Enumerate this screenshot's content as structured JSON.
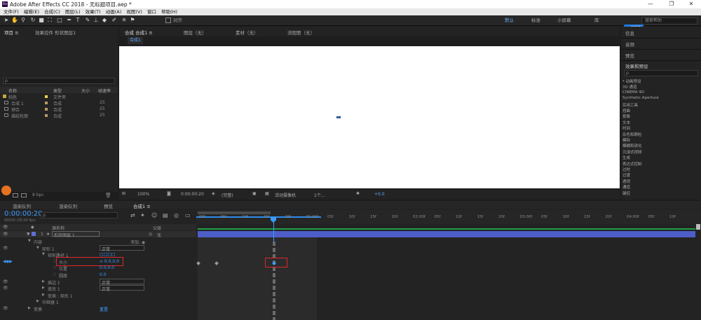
{
  "window": {
    "title": "Adobe After Effects CC 2018 - 无标题项目.aep *",
    "logo_text": "Ae",
    "minimize": "—",
    "restore": "❐",
    "close": "✕"
  },
  "menu": [
    "文件(F)",
    "编辑(E)",
    "合成(C)",
    "图层(L)",
    "效果(T)",
    "动画(A)",
    "视图(V)",
    "窗口",
    "帮助(H)"
  ],
  "toolbar": {
    "snap_label": "对齐",
    "workspaces": [
      "默认",
      "标准",
      "小屏幕",
      "库"
    ],
    "search_placeholder": "搜索帮助",
    "cloud_badge": "已加速"
  },
  "project": {
    "tab_label": "项目 ≡",
    "effects_tab": "效果控件 形状图层1",
    "search_placeholder": "ρ.",
    "columns": [
      "名称",
      "类型",
      "大小",
      "帧速率"
    ],
    "items": [
      {
        "name": "纯色",
        "type": "文件夹",
        "fps": ""
      },
      {
        "name": "合成 1",
        "type": "合成",
        "fps": "25"
      },
      {
        "name": "预合",
        "type": "合成",
        "fps": "25"
      },
      {
        "name": "描绘轮廓",
        "type": "合成",
        "fps": "25"
      }
    ],
    "bpc": "8 bpc"
  },
  "comp": {
    "tabs": [
      "合成 合成1 ≡",
      "图层（无）",
      "素材（无）",
      "流程图（无）"
    ],
    "breadcrumb": "合成1",
    "zoom": "100%",
    "timecode": "0:00:00:20",
    "resolution": "(完整)",
    "camera": "活动摄像机",
    "views": "1个...",
    "offset": "+0.0"
  },
  "right": {
    "items": [
      "信息",
      "音频",
      "预览"
    ],
    "effects_title": "效果和预设",
    "search_placeholder": "ρ.",
    "tree": [
      "* 动画预设",
      "3D 通道",
      "CINEMA 4D",
      "Synthetic Aperture",
      "实用工具",
      "扭曲",
      "抠像",
      "文本",
      "时间",
      "杂色和颗粒",
      "模拟",
      "模糊和锐化",
      "沉浸式视频",
      "生成",
      "表达式控制",
      "过时",
      "过渡",
      "透视",
      "通道",
      "键控"
    ]
  },
  "timeline": {
    "tabs": [
      "渲染队列",
      "渲染队列",
      "预览",
      "合成1 ≡"
    ],
    "timecode": "0:00:00:20",
    "timecode_sub": "00020 (25.00 fps)",
    "search_placeholder": "ρ.",
    "col_source": "源名称",
    "col_parent": "父级",
    "parent_value": "无",
    "layer_num": "1",
    "layer_name": "形状图层 1",
    "add_label": "添加: ◉",
    "ruler": [
      "00f",
      "05f",
      "10f",
      "15f",
      "20f",
      "01:00f",
      "05f",
      "10f",
      "15f",
      "20f",
      "02:00f",
      "05f",
      "10f",
      "15f",
      "20f",
      "03:00f",
      "05f",
      "10f",
      "15f",
      "20f",
      "04:00f",
      "05f",
      "10f"
    ],
    "props": [
      {
        "label": "内容",
        "value": ""
      },
      {
        "label": "矩形 1",
        "value": "正常"
      },
      {
        "label": "矩形路径 1",
        "value": "□□□□"
      },
      {
        "label": "大小",
        "value": "∞ 0.0,0.0"
      },
      {
        "label": "位置",
        "value": "0.0,0.0"
      },
      {
        "label": "圆度",
        "value": "0.0"
      },
      {
        "label": "描边 1",
        "value": "正常"
      },
      {
        "label": "填充 1",
        "value": "正常"
      },
      {
        "label": "变换 : 矩形 1",
        "value": ""
      },
      {
        "label": "中继器 1",
        "value": ""
      },
      {
        "label": "变换",
        "value": "重置"
      }
    ]
  },
  "colors": {
    "accent": "#2d8ceb",
    "timeline_bar": "#4d5ec8",
    "highlight": "#e0262a",
    "green": "#1fa04a"
  }
}
